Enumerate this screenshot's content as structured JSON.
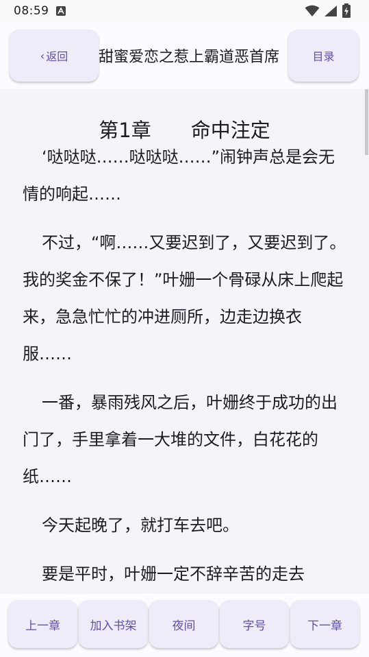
{
  "status_bar": {
    "time": "08:59",
    "notification_icon": "a-box-icon",
    "icons": [
      "wifi-icon",
      "signal-icon",
      "battery-icon"
    ]
  },
  "header": {
    "back_label": "返回",
    "back_icon": "chevron-left-icon",
    "title": "甜蜜爱恋之惹上霸道恶首席",
    "toc_label": "目录"
  },
  "reader": {
    "chapter_title": "第1章　　命中注定",
    "paragraphs": [
      "‘哒哒哒……哒哒哒……”闹钟声总是会无情的响起……",
      "不过，“啊……又要迟到了，又要迟到了。我的奖金不保了！”叶姗一个骨碌从床上爬起来，急急忙忙的冲进厕所，边走边换衣服……",
      "一番，暴雨残风之后，叶姗终于成功的出门了，手里拿着一大堆的文件，白花花的纸……",
      "今天起晚了，就打车去吧。",
      "要是平时，叶姗一定不辞辛苦的走去"
    ]
  },
  "bottom_bar": {
    "prev_chapter": "上一章",
    "add_to_shelf": "加入书架",
    "night_mode": "夜间",
    "font_size": "字号",
    "next_chapter": "下一章"
  },
  "colors": {
    "accent": "#5e51a8",
    "button_bg": "#efebf8",
    "reader_bg": "#f6f3fb"
  }
}
